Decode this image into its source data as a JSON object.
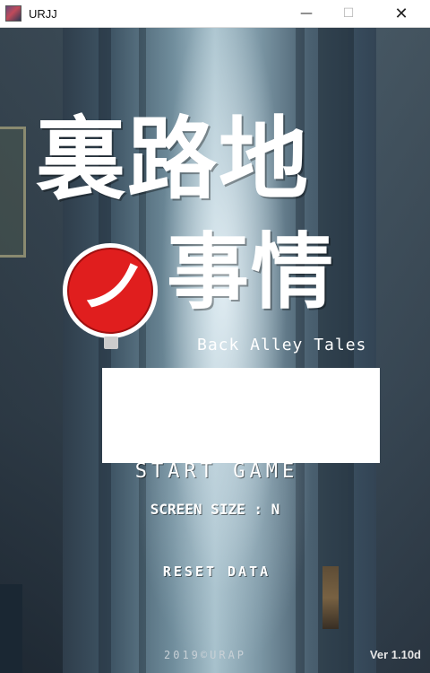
{
  "window": {
    "title": "URJJ",
    "min_glyph": "—",
    "max_glyph": "☐",
    "close_glyph": "✕"
  },
  "logo": {
    "main": "裏路地",
    "sub": "事情",
    "badge_glyph": "ノ",
    "badge_color": "#e01e1e",
    "tagline": "Back Alley Tales"
  },
  "menu": {
    "start": "START GAME",
    "screen_size": "SCREEN SIZE : N",
    "reset": "RESET DATA"
  },
  "footer": {
    "copyright": "2019©URAP",
    "version": "Ver 1.10d"
  }
}
